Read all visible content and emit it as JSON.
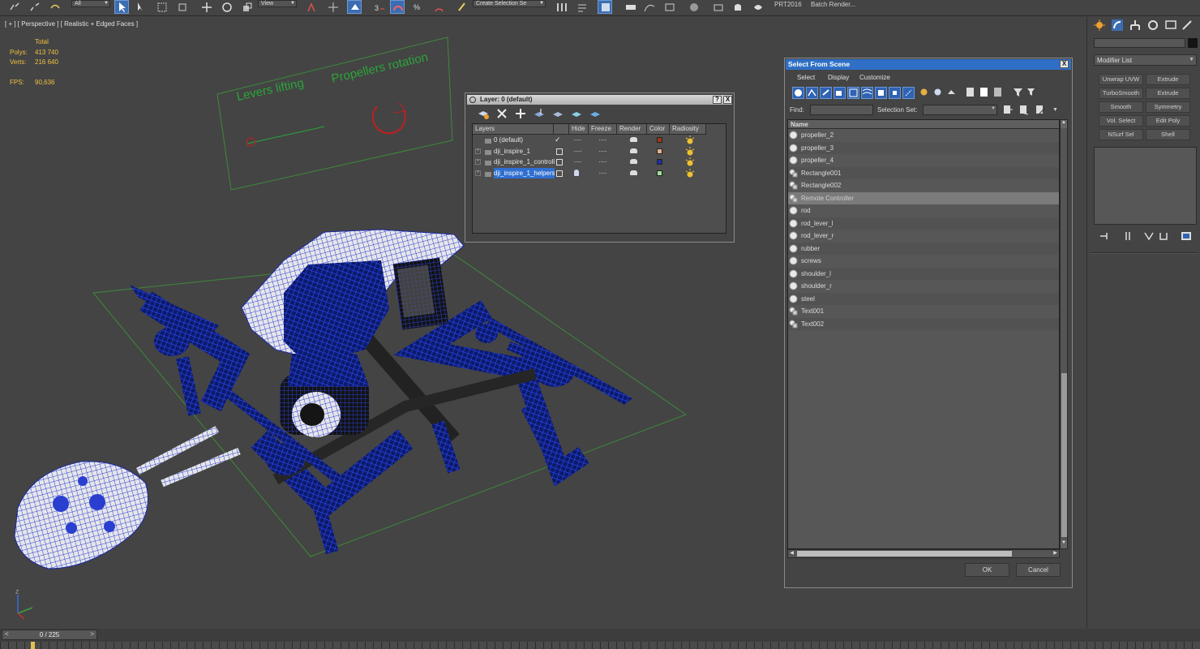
{
  "toolbar": {
    "selection_filter": "All",
    "ref_coord": "View",
    "named_selection": "Create Selection Se",
    "prt_label": "PRT2016",
    "batch_render": "Batch Render..."
  },
  "viewport": {
    "label": "[ + ] [ Perspective ] [ Realistic + Edged Faces ]",
    "stats": {
      "header": "Total",
      "polys_label": "Polys:",
      "polys_value": "413 740",
      "verts_label": "Verts:",
      "verts_value": "216 640",
      "fps_label": "FPS:",
      "fps_value": "90,636"
    },
    "annotations": {
      "levers": "Levers lifting",
      "propellers": "Propellers rotation"
    },
    "axis": {
      "x": "X",
      "y": "Y",
      "z": "Z"
    }
  },
  "timeline": {
    "frame_label": "0 / 225",
    "prev": "<",
    "next": ">"
  },
  "layer_window": {
    "title": "Layer: 0 (default)",
    "help": "?",
    "close": "X",
    "columns": [
      "Layers",
      "Hide",
      "Freeze",
      "Render",
      "Color",
      "Radiosity"
    ],
    "rows": [
      {
        "name": "0 (default)",
        "color": "#9a3a1c",
        "current": true
      },
      {
        "name": "dji_inspire_1",
        "color": "#e6b08a"
      },
      {
        "name": "dji_inspire_1_controller",
        "color": "#1c2ea0"
      },
      {
        "name": "dji_inspire_1_helpers",
        "color": "#9ee09a",
        "selected": true
      }
    ]
  },
  "select_from_scene": {
    "title": "Select From Scene",
    "close": "X",
    "menu": [
      "Select",
      "Display",
      "Customize"
    ],
    "find_label": "Find:",
    "selection_set_label": "Selection Set:",
    "column_name": "Name",
    "items": [
      {
        "name": "propeller_2",
        "icon": "sphere"
      },
      {
        "name": "propeller_3",
        "icon": "sphere"
      },
      {
        "name": "propeller_4",
        "icon": "sphere"
      },
      {
        "name": "Rectangle001",
        "icon": "shape"
      },
      {
        "name": "Rectangle002",
        "icon": "shape"
      },
      {
        "name": "Remote Controller",
        "icon": "shape",
        "highlighted": true
      },
      {
        "name": "rod",
        "icon": "sphere"
      },
      {
        "name": "rod_lever_l",
        "icon": "sphere"
      },
      {
        "name": "rod_lever_r",
        "icon": "sphere"
      },
      {
        "name": "rubber",
        "icon": "sphere"
      },
      {
        "name": "screws",
        "icon": "sphere"
      },
      {
        "name": "shoulder_l",
        "icon": "sphere"
      },
      {
        "name": "shoulder_r",
        "icon": "sphere"
      },
      {
        "name": "steel",
        "icon": "sphere"
      },
      {
        "name": "Text001",
        "icon": "shape"
      },
      {
        "name": "Text002",
        "icon": "shape"
      }
    ],
    "ok": "OK",
    "cancel": "Cancel"
  },
  "command_panel": {
    "modifier_list": "Modifier List",
    "modifiers": [
      [
        "Unwrap UVW",
        "Extrude"
      ],
      [
        "TurboSmooth",
        "Extrude"
      ],
      [
        "Smooth",
        "Symmetry"
      ],
      [
        "Vol. Select",
        "Edit Poly"
      ],
      [
        "NSurf Sel",
        "Shell"
      ]
    ]
  },
  "colors": {
    "viewport_bg": "#444444",
    "wire_blue": "#1f3fd8",
    "grid_green": "#3d8a3a",
    "stats_yellow": "#f0c040",
    "title_blue": "#2f6fc5"
  }
}
